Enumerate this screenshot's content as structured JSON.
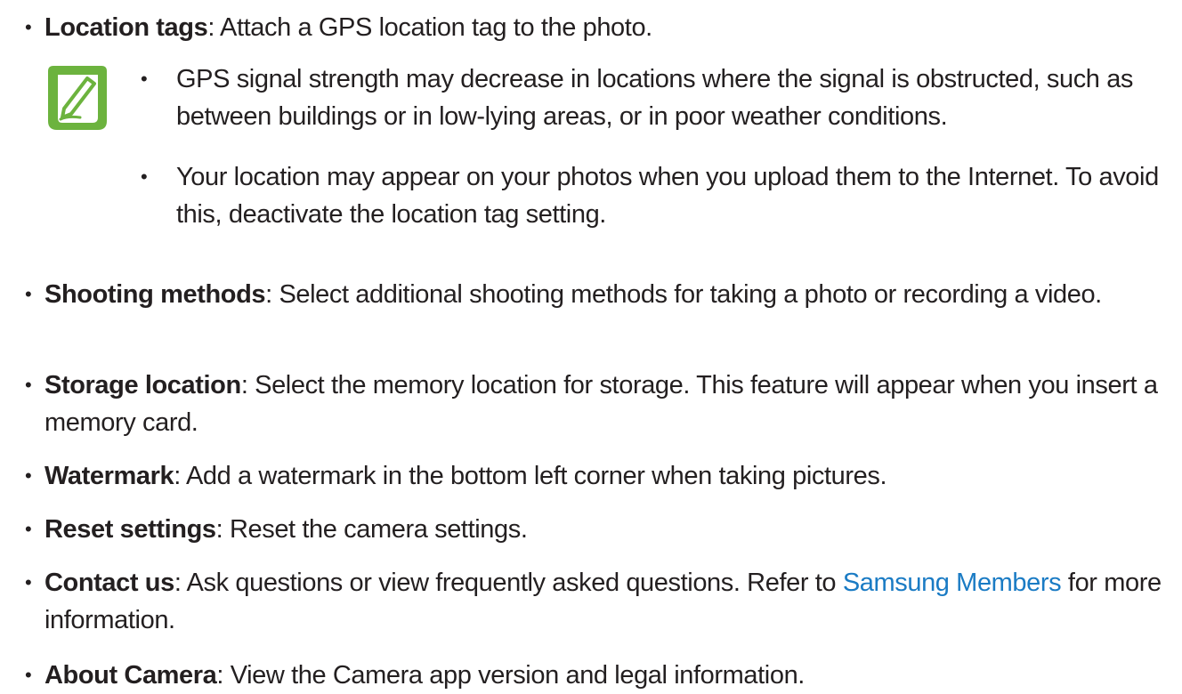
{
  "bullet_glyph": "•",
  "items_top": [
    {
      "term": "Location tags",
      "text": ": Attach a GPS location tag to the photo."
    }
  ],
  "note": {
    "icon": "note-pencil-icon",
    "icon_color": "#6cb33e",
    "items": [
      "GPS signal strength may decrease in locations where the signal is obstructed, such as between buildings or in low-lying areas, or in poor weather conditions.",
      "Your location may appear on your photos when you upload them to the Internet. To avoid this, deactivate the location tag setting."
    ]
  },
  "items": [
    {
      "term": "Shooting methods",
      "text": ": Select additional shooting methods for taking a photo or recording a video."
    },
    {
      "term": "Storage location",
      "text": ": Select the memory location for storage. This feature will appear when you insert a memory card."
    },
    {
      "term": "Watermark",
      "text": ": Add a watermark in the bottom left corner when taking pictures."
    },
    {
      "term": "Reset settings",
      "text": ": Reset the camera settings."
    },
    {
      "term": "Contact us",
      "text_before": ": Ask questions or view frequently asked questions. Refer to ",
      "link": "Samsung Members",
      "text_after": " for more information."
    },
    {
      "term": "About Camera",
      "text": ": View the Camera app version and legal information."
    }
  ],
  "colors": {
    "text": "#231f20",
    "link": "#1a7bc4",
    "note_icon": "#6cb33e"
  }
}
